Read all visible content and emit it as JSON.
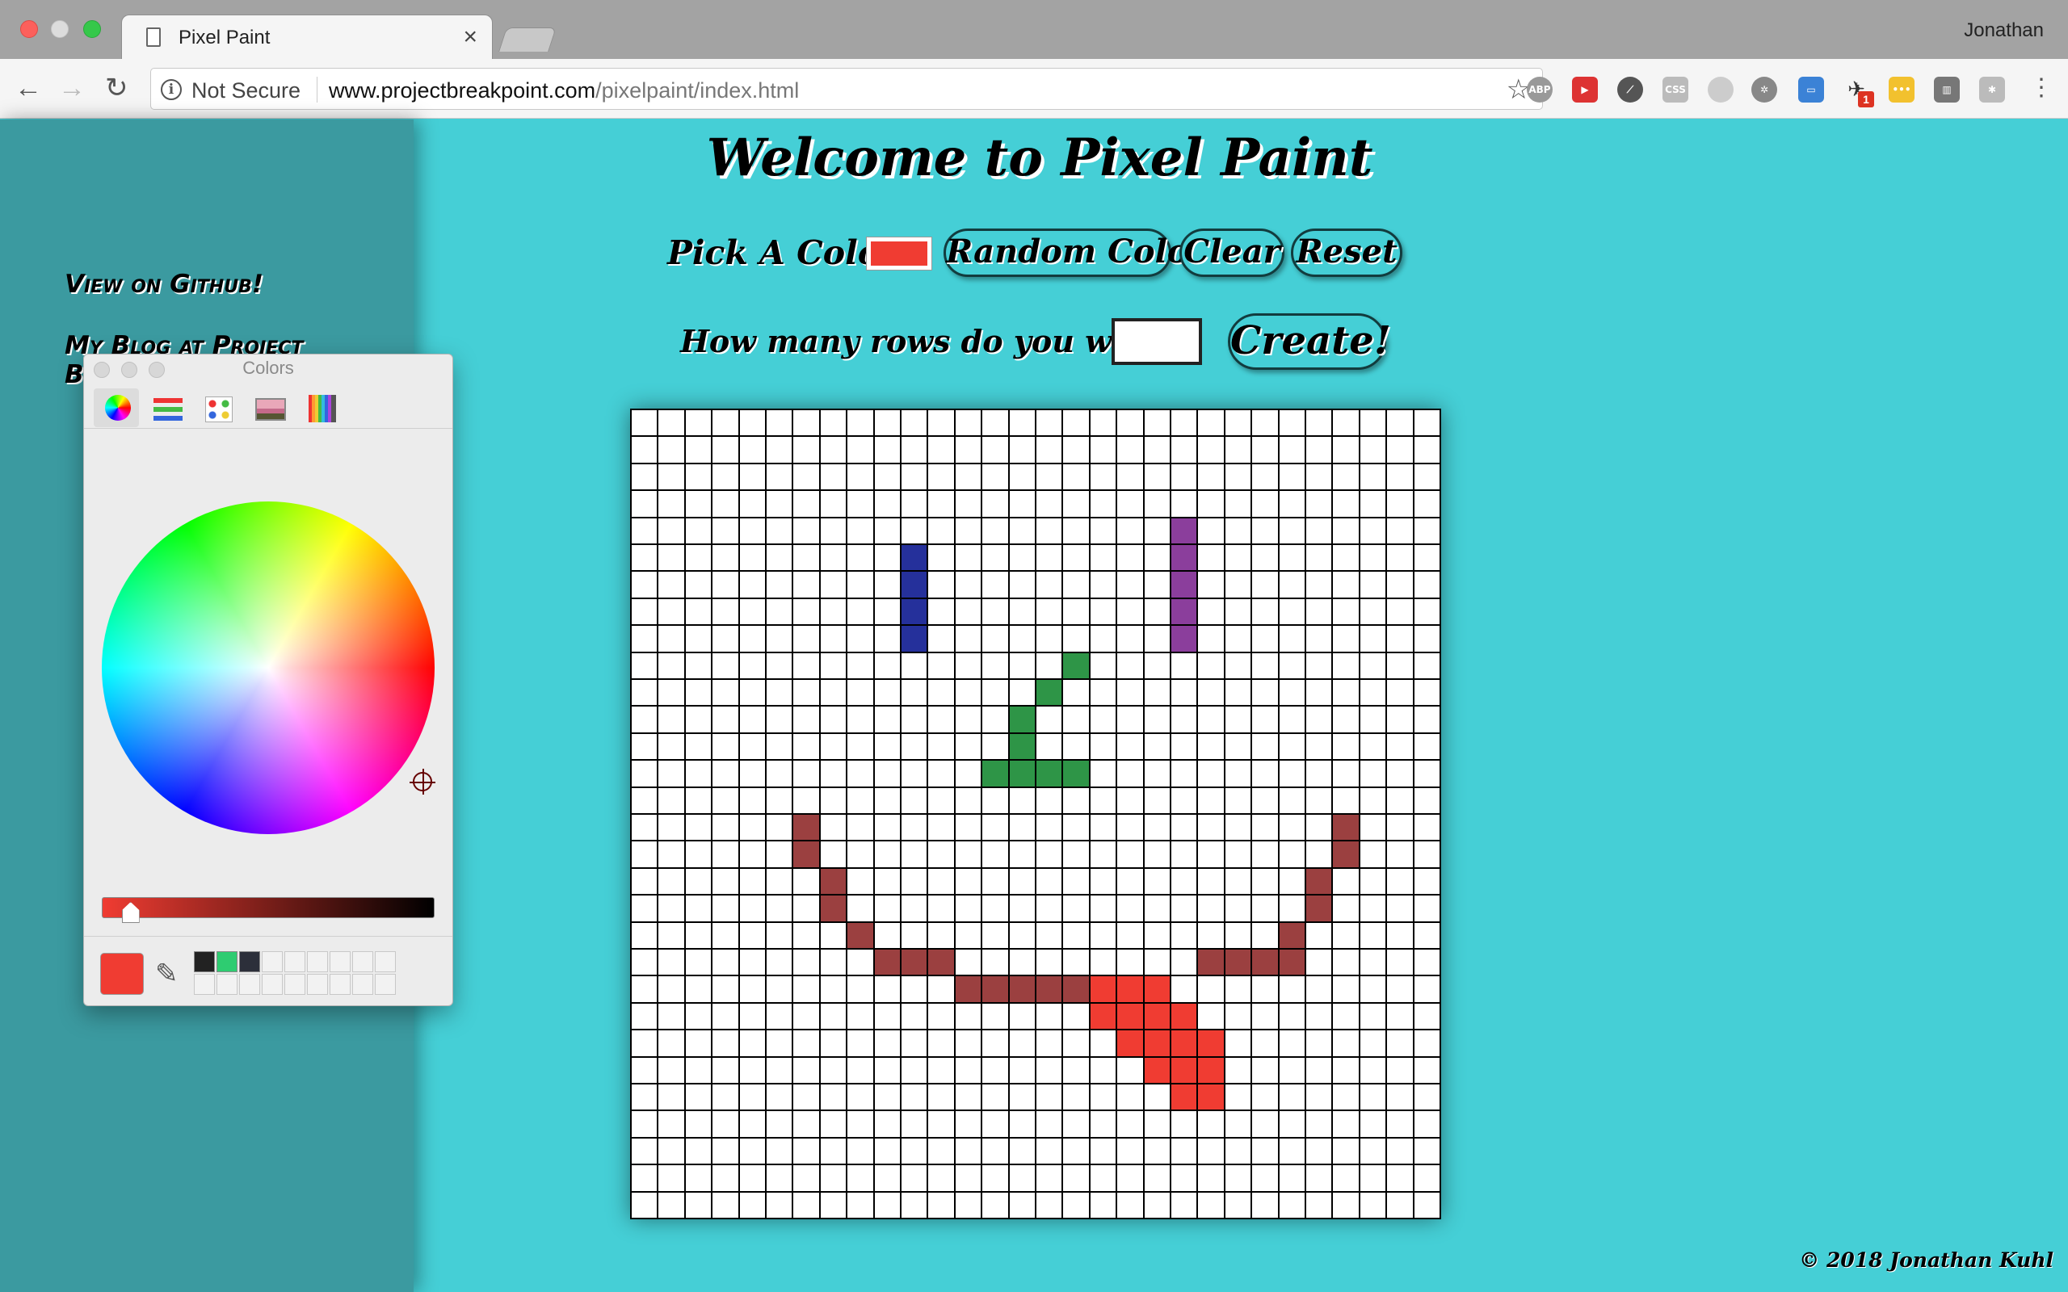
{
  "browser": {
    "tab_title": "Pixel Paint",
    "tab_close": "×",
    "profile_name": "Jonathan",
    "security_label": "Not Secure",
    "url_host": "www.projectbreakpoint.com",
    "url_path": "/pixelpaint/index.html",
    "extensions": [
      "adblock-plus-icon",
      "video-speed-icon",
      "compass-icon",
      "css-viewer-icon",
      "flow-icon",
      "gear-icon",
      "folder-icon",
      "airplane-icon",
      "lastpass-icon",
      "trash-icon",
      "settings-icon"
    ],
    "extension_badge": "1"
  },
  "sidebar": {
    "github_link": "View on Github!",
    "blog_link": "My Blog at Project Breakpoint!"
  },
  "main": {
    "title": "Welcome to Pixel Paint",
    "pick_color_label": "Pick A Color:",
    "current_color": "#f03c32",
    "random_button": "Random Color",
    "clear_button": "Clear",
    "reset_button": "Reset",
    "rows_label": "How many rows do you want?",
    "rows_value": "",
    "create_button": "Create!"
  },
  "grid": {
    "rows": 30,
    "cols": 30,
    "painted": [
      {
        "r": 4,
        "c": 20,
        "color": "#8b3e9c"
      },
      {
        "r": 5,
        "c": 10,
        "color": "#25309b"
      },
      {
        "r": 5,
        "c": 20,
        "color": "#8b3e9c"
      },
      {
        "r": 6,
        "c": 10,
        "color": "#25309b"
      },
      {
        "r": 6,
        "c": 20,
        "color": "#8b3e9c"
      },
      {
        "r": 7,
        "c": 10,
        "color": "#25309b"
      },
      {
        "r": 7,
        "c": 20,
        "color": "#8b3e9c"
      },
      {
        "r": 8,
        "c": 10,
        "color": "#25309b"
      },
      {
        "r": 8,
        "c": 20,
        "color": "#8b3e9c"
      },
      {
        "r": 9,
        "c": 16,
        "color": "#2e9547"
      },
      {
        "r": 10,
        "c": 15,
        "color": "#2e9547"
      },
      {
        "r": 11,
        "c": 14,
        "color": "#2e9547"
      },
      {
        "r": 12,
        "c": 14,
        "color": "#2e9547"
      },
      {
        "r": 13,
        "c": 13,
        "color": "#2e9547"
      },
      {
        "r": 13,
        "c": 14,
        "color": "#2e9547"
      },
      {
        "r": 13,
        "c": 15,
        "color": "#2e9547"
      },
      {
        "r": 13,
        "c": 16,
        "color": "#2e9547"
      },
      {
        "r": 15,
        "c": 6,
        "color": "#9b4040"
      },
      {
        "r": 15,
        "c": 26,
        "color": "#9b4040"
      },
      {
        "r": 16,
        "c": 6,
        "color": "#9b4040"
      },
      {
        "r": 16,
        "c": 26,
        "color": "#9b4040"
      },
      {
        "r": 17,
        "c": 7,
        "color": "#9b4040"
      },
      {
        "r": 17,
        "c": 25,
        "color": "#9b4040"
      },
      {
        "r": 18,
        "c": 7,
        "color": "#9b4040"
      },
      {
        "r": 18,
        "c": 25,
        "color": "#9b4040"
      },
      {
        "r": 19,
        "c": 8,
        "color": "#9b4040"
      },
      {
        "r": 19,
        "c": 24,
        "color": "#9b4040"
      },
      {
        "r": 20,
        "c": 9,
        "color": "#9b4040"
      },
      {
        "r": 20,
        "c": 10,
        "color": "#9b4040"
      },
      {
        "r": 20,
        "c": 11,
        "color": "#9b4040"
      },
      {
        "r": 20,
        "c": 21,
        "color": "#9b4040"
      },
      {
        "r": 20,
        "c": 22,
        "color": "#9b4040"
      },
      {
        "r": 20,
        "c": 23,
        "color": "#9b4040"
      },
      {
        "r": 20,
        "c": 24,
        "color": "#9b4040"
      },
      {
        "r": 21,
        "c": 12,
        "color": "#9b4040"
      },
      {
        "r": 21,
        "c": 13,
        "color": "#9b4040"
      },
      {
        "r": 21,
        "c": 14,
        "color": "#9b4040"
      },
      {
        "r": 21,
        "c": 15,
        "color": "#9b4040"
      },
      {
        "r": 21,
        "c": 16,
        "color": "#9b4040"
      },
      {
        "r": 21,
        "c": 17,
        "color": "#f03c32"
      },
      {
        "r": 21,
        "c": 18,
        "color": "#f03c32"
      },
      {
        "r": 21,
        "c": 19,
        "color": "#f03c32"
      },
      {
        "r": 22,
        "c": 17,
        "color": "#f03c32"
      },
      {
        "r": 22,
        "c": 18,
        "color": "#f03c32"
      },
      {
        "r": 22,
        "c": 19,
        "color": "#f03c32"
      },
      {
        "r": 22,
        "c": 20,
        "color": "#f03c32"
      },
      {
        "r": 23,
        "c": 18,
        "color": "#f03c32"
      },
      {
        "r": 23,
        "c": 19,
        "color": "#f03c32"
      },
      {
        "r": 23,
        "c": 20,
        "color": "#f03c32"
      },
      {
        "r": 23,
        "c": 21,
        "color": "#f03c32"
      },
      {
        "r": 24,
        "c": 19,
        "color": "#f03c32"
      },
      {
        "r": 24,
        "c": 20,
        "color": "#f03c32"
      },
      {
        "r": 24,
        "c": 21,
        "color": "#f03c32"
      },
      {
        "r": 25,
        "c": 20,
        "color": "#f03c32"
      },
      {
        "r": 25,
        "c": 21,
        "color": "#f03c32"
      }
    ]
  },
  "footer": {
    "copyright": "© 2018 Jonathan Kuhl"
  },
  "colors_panel": {
    "title": "Colors",
    "tabs": [
      "color-wheel-icon",
      "color-sliders-icon",
      "color-palettes-icon",
      "image-palettes-icon",
      "pencils-icon"
    ],
    "selected_color": "#f03c32",
    "brightness": 0.06,
    "saved_swatches": [
      "#222222",
      "#2ecc71",
      "#2c2f3a"
    ]
  }
}
